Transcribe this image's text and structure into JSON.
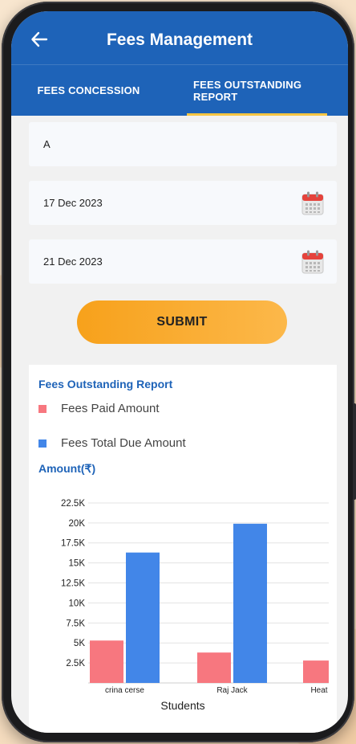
{
  "header": {
    "title": "Fees Management"
  },
  "tabs": [
    {
      "label": "FEES CONCESSION",
      "active": false
    },
    {
      "label": "FEES OUTSTANDING REPORT",
      "active": true
    }
  ],
  "form": {
    "class_value": "A",
    "from_date": "17 Dec 2023",
    "to_date": "21 Dec 2023",
    "submit_label": "SUBMIT"
  },
  "report": {
    "title": "Fees Outstanding Report",
    "y_title": "Amount(₹)",
    "x_title": "Students"
  },
  "colors": {
    "primary": "#1e63b8",
    "tab_indicator": "#f5c542",
    "submit_gradient_start": "#f7a11b",
    "submit_gradient_end": "#fcb84a",
    "paid": "#f7777f",
    "due": "#4286e8"
  },
  "icons": [
    "back-arrow-icon",
    "calendar-icon"
  ],
  "chart_data": {
    "type": "bar",
    "categories": [
      "crina cerse",
      "Raj Jack",
      "Heat"
    ],
    "series": [
      {
        "name": "Fees Paid Amount",
        "values": [
          5300,
          3800,
          2800
        ]
      },
      {
        "name": "Fees Total Due Amount",
        "values": [
          16300,
          19900,
          null
        ]
      }
    ],
    "yticks": [
      "2.5K",
      "5K",
      "7.5K",
      "10K",
      "12.5K",
      "15K",
      "17.5K",
      "20K",
      "22.5K"
    ],
    "ylim": [
      0,
      22500
    ],
    "grid": true,
    "legend": "top-left"
  }
}
